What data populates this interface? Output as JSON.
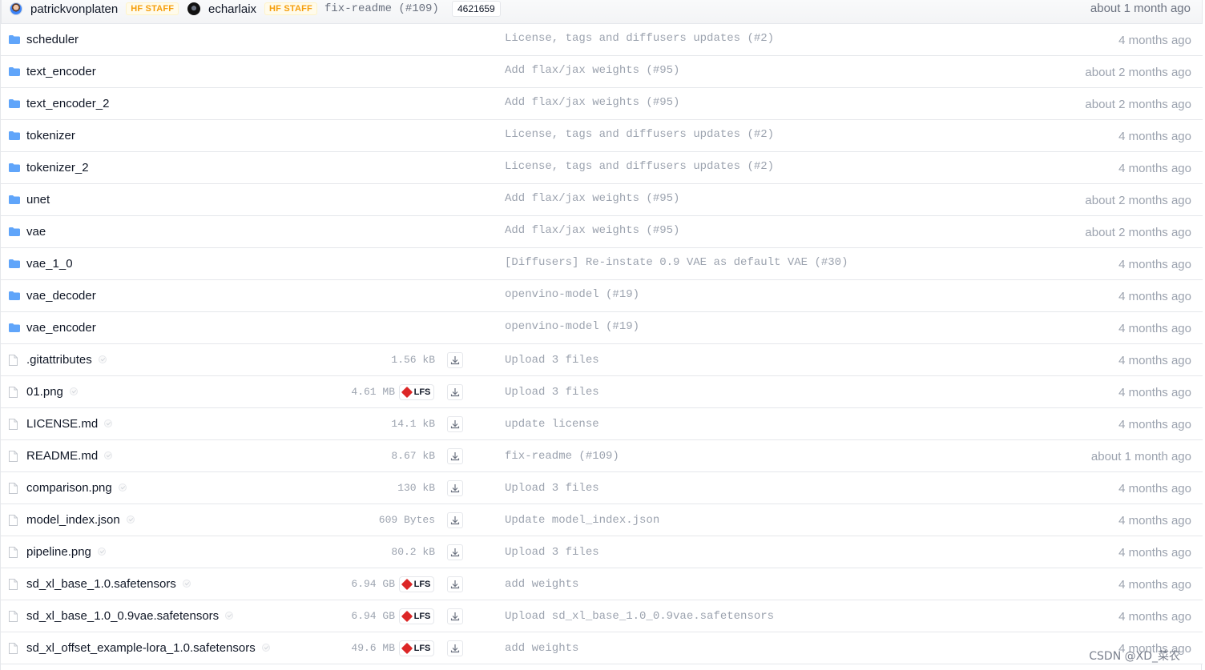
{
  "header": {
    "authors": [
      {
        "name": "patrickvonplaten",
        "badge": "HF STAFF"
      },
      {
        "name": "echarlaix",
        "badge": "HF STAFF"
      }
    ],
    "commit_message": "fix-readme (#109)",
    "commit_hash": "4621659",
    "date": "about 1 month ago"
  },
  "folders": [
    {
      "name": "scheduler",
      "message": "License, tags and diffusers updates (#2)",
      "date": "4 months ago"
    },
    {
      "name": "text_encoder",
      "message": "Add flax/jax weights (#95)",
      "date": "about 2 months ago"
    },
    {
      "name": "text_encoder_2",
      "message": "Add flax/jax weights (#95)",
      "date": "about 2 months ago"
    },
    {
      "name": "tokenizer",
      "message": "License, tags and diffusers updates (#2)",
      "date": "4 months ago"
    },
    {
      "name": "tokenizer_2",
      "message": "License, tags and diffusers updates (#2)",
      "date": "4 months ago"
    },
    {
      "name": "unet",
      "message": "Add flax/jax weights (#95)",
      "date": "about 2 months ago"
    },
    {
      "name": "vae",
      "message": "Add flax/jax weights (#95)",
      "date": "about 2 months ago"
    },
    {
      "name": "vae_1_0",
      "message": "[Diffusers] Re-instate 0.9 VAE as default VAE (#30)",
      "date": "4 months ago"
    },
    {
      "name": "vae_decoder",
      "message": "openvino-model (#19)",
      "date": "4 months ago"
    },
    {
      "name": "vae_encoder",
      "message": "openvino-model (#19)",
      "date": "4 months ago"
    }
  ],
  "files": [
    {
      "name": ".gitattributes",
      "size": "1.56 kB",
      "lfs": false,
      "message": "Upload 3 files",
      "date": "4 months ago"
    },
    {
      "name": "01.png",
      "size": "4.61 MB",
      "lfs": true,
      "message": "Upload 3 files",
      "date": "4 months ago"
    },
    {
      "name": "LICENSE.md",
      "size": "14.1 kB",
      "lfs": false,
      "message": "update license",
      "date": "4 months ago"
    },
    {
      "name": "README.md",
      "size": "8.67 kB",
      "lfs": false,
      "message": "fix-readme (#109)",
      "date": "about 1 month ago"
    },
    {
      "name": "comparison.png",
      "size": "130 kB",
      "lfs": false,
      "message": "Upload 3 files",
      "date": "4 months ago"
    },
    {
      "name": "model_index.json",
      "size": "609 Bytes",
      "lfs": false,
      "message": "Update model_index.json",
      "date": "4 months ago"
    },
    {
      "name": "pipeline.png",
      "size": "80.2 kB",
      "lfs": false,
      "message": "Upload 3 files",
      "date": "4 months ago"
    },
    {
      "name": "sd_xl_base_1.0.safetensors",
      "size": "6.94 GB",
      "lfs": true,
      "message": "add weights",
      "date": "4 months ago"
    },
    {
      "name": "sd_xl_base_1.0_0.9vae.safetensors",
      "size": "6.94 GB",
      "lfs": true,
      "message": "Upload sd_xl_base_1.0_0.9vae.safetensors",
      "date": "4 months ago"
    },
    {
      "name": "sd_xl_offset_example-lora_1.0.safetensors",
      "size": "49.6 MB",
      "lfs": true,
      "message": "add weights",
      "date": "4 months ago"
    }
  ],
  "lfs_label": "LFS",
  "watermark": "CSDN @XD_菜农",
  "colors": {
    "folder": "#60a5fa",
    "lfs": "#dc2626",
    "staff_badge": "#f59e0b"
  }
}
